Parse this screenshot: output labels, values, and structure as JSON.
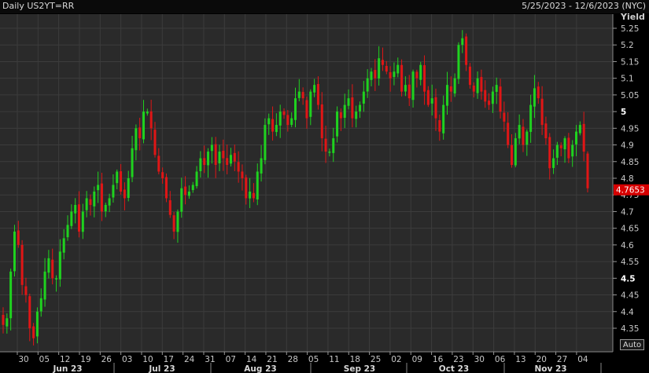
{
  "header": {
    "title": "Daily US2YT=RR",
    "date_range": "5/25/2023 - 12/6/2023 (NYC)"
  },
  "controls": {
    "auto_label": "Auto"
  },
  "colors": {
    "up": "#1fd21f",
    "down": "#e01616",
    "background": "#2a2a2a",
    "grid": "#3c3c3c",
    "last_price_bg": "#d60000"
  },
  "chart_data": {
    "type": "candlestick",
    "ylabel": "Yield",
    "ylim": [
      4.3,
      5.27
    ],
    "yticks": [
      "5.25",
      "5.2",
      "5.15",
      "5.1",
      "5.05",
      "5",
      "4.95",
      "4.9",
      "4.85",
      "4.8",
      "4.75",
      "4.7",
      "4.65",
      "4.6",
      "4.55",
      "4.5",
      "4.45",
      "4.4",
      "4.35"
    ],
    "bold_yticks": [
      "5",
      "4.5"
    ],
    "last_value": "4.7653",
    "x_day_labels": [
      "30",
      "05",
      "12",
      "19",
      "26",
      "03",
      "10",
      "17",
      "24",
      "31",
      "07",
      "14",
      "21",
      "28",
      "05",
      "11",
      "18",
      "25",
      "02",
      "09",
      "16",
      "23",
      "30",
      "06",
      "13",
      "20",
      "27",
      "04"
    ],
    "x_month_labels": [
      "Jun 23",
      "Jul 23",
      "Aug 23",
      "Sep 23",
      "Oct 23",
      "Nov 23"
    ],
    "closes": [
      4.36,
      4.38,
      4.52,
      4.64,
      4.6,
      4.48,
      4.45,
      4.35,
      4.32,
      4.4,
      4.44,
      4.52,
      4.56,
      4.5,
      4.5,
      4.58,
      4.62,
      4.66,
      4.7,
      4.72,
      4.64,
      4.7,
      4.74,
      4.72,
      4.76,
      4.78,
      4.7,
      4.72,
      4.74,
      4.78,
      4.82,
      4.76,
      4.74,
      4.8,
      4.89,
      4.95,
      4.92,
      5.0,
      5.0,
      4.95,
      4.87,
      4.82,
      4.8,
      4.74,
      4.69,
      4.64,
      4.7,
      4.77,
      4.75,
      4.76,
      4.78,
      4.82,
      4.86,
      4.84,
      4.88,
      4.9,
      4.84,
      4.88,
      4.86,
      4.84,
      4.87,
      4.85,
      4.82,
      4.8,
      4.74,
      4.76,
      4.74,
      4.82,
      4.86,
      4.96,
      4.98,
      4.94,
      4.96,
      5.0,
      4.99,
      4.96,
      4.98,
      5.04,
      5.06,
      5.04,
      4.98,
      5.06,
      5.08,
      5.02,
      4.92,
      4.88,
      4.88,
      4.92,
      5.0,
      4.98,
      5.02,
      5.04,
      4.98,
      5.0,
      5.02,
      5.06,
      5.1,
      5.12,
      5.1,
      5.16,
      5.14,
      5.12,
      5.1,
      5.12,
      5.14,
      5.06,
      5.08,
      5.04,
      5.12,
      5.1,
      5.14,
      5.06,
      5.02,
      5.04,
      4.98,
      4.94,
      5.02,
      5.08,
      5.06,
      5.1,
      5.2,
      5.22,
      5.14,
      5.08,
      5.06,
      5.1,
      5.06,
      5.03,
      5.02,
      5.06,
      5.08,
      5.0,
      4.97,
      4.9,
      4.84,
      4.92,
      4.96,
      4.9,
      4.94,
      5.02,
      5.07,
      5.04,
      4.96,
      4.92,
      4.83,
      4.86,
      4.9,
      4.89,
      4.92,
      4.86,
      4.9,
      4.94,
      4.96,
      4.88,
      4.77
    ]
  }
}
